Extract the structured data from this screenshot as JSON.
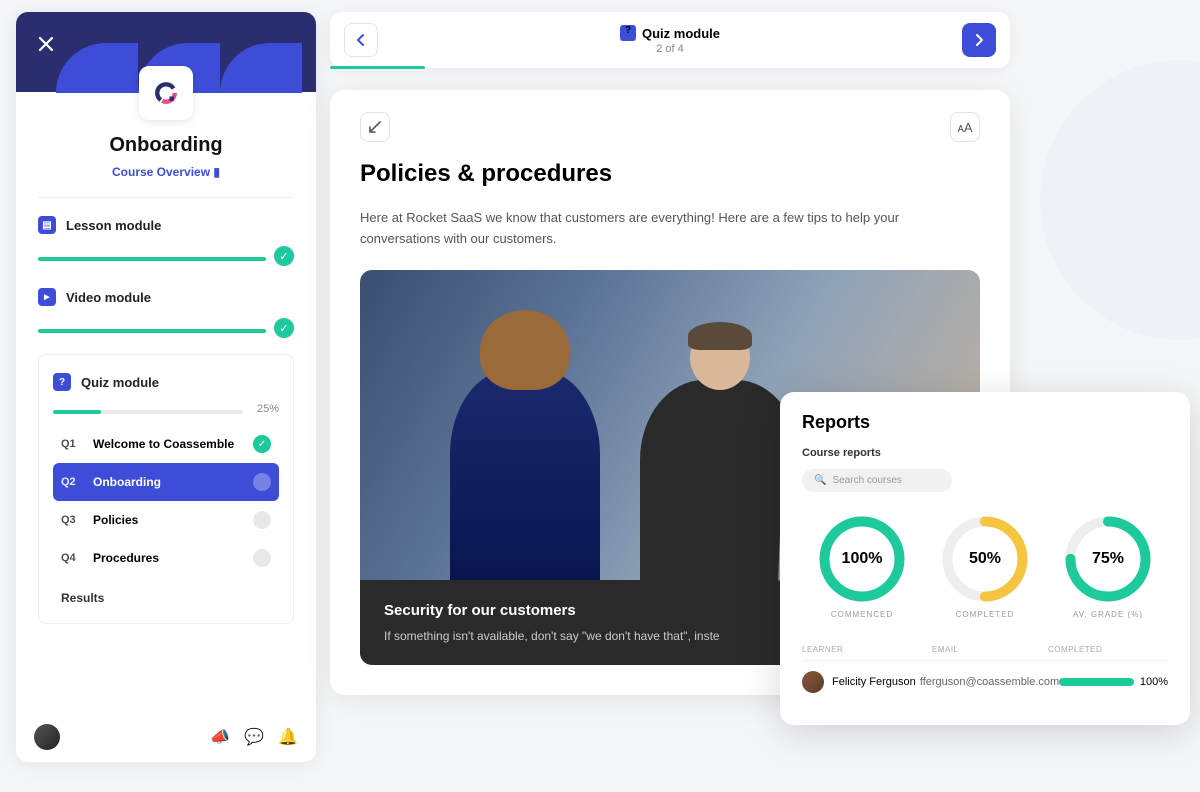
{
  "sidebar": {
    "course_title": "Onboarding",
    "overview_label": "Course Overview",
    "modules": [
      {
        "icon": "lesson",
        "label": "Lesson module",
        "progress": 100,
        "complete": true
      },
      {
        "icon": "video",
        "label": "Video module",
        "progress": 100,
        "complete": true
      }
    ],
    "quiz": {
      "label": "Quiz module",
      "progress": 25,
      "progress_label": "25%",
      "items": [
        {
          "num": "Q1",
          "label": "Welcome to Coassemble",
          "done": true,
          "active": false
        },
        {
          "num": "Q2",
          "label": "Onboarding",
          "done": false,
          "active": true
        },
        {
          "num": "Q3",
          "label": "Policies",
          "done": false,
          "active": false
        },
        {
          "num": "Q4",
          "label": "Procedures",
          "done": false,
          "active": false
        }
      ],
      "results_label": "Results"
    }
  },
  "topbar": {
    "title": "Quiz module",
    "subtitle": "2 of 4"
  },
  "content": {
    "title": "Policies & procedures",
    "body": "Here at Rocket SaaS we know that customers are everything! Here are a few tips to help your conversations with our customers.",
    "hero_title": "Security for our customers",
    "hero_body": "If something isn't available, don't say \"we don't have that\", inste"
  },
  "reports": {
    "title": "Reports",
    "subtitle": "Course reports",
    "search_placeholder": "Search courses",
    "donuts": [
      {
        "value": 100,
        "label_text": "100%",
        "label": "COMMENCED",
        "color": "#1ec99b"
      },
      {
        "value": 50,
        "label_text": "50%",
        "label": "COMPLETED",
        "color": "#f5c542"
      },
      {
        "value": 75,
        "label_text": "75%",
        "label": "AV. GRADE (%)",
        "color": "#1ec99b"
      }
    ],
    "columns": [
      "LEARNER",
      "EMAIL",
      "COMPLETED"
    ],
    "rows": [
      {
        "name": "Felicity Ferguson",
        "email": "fferguson@coassemble.com",
        "pct": "100%"
      }
    ]
  },
  "chart_data": [
    {
      "type": "pie",
      "title": "COMMENCED",
      "values": [
        100
      ],
      "ylim": [
        0,
        100
      ]
    },
    {
      "type": "pie",
      "title": "COMPLETED",
      "values": [
        50
      ],
      "ylim": [
        0,
        100
      ]
    },
    {
      "type": "pie",
      "title": "AV. GRADE (%)",
      "values": [
        75
      ],
      "ylim": [
        0,
        100
      ]
    }
  ]
}
